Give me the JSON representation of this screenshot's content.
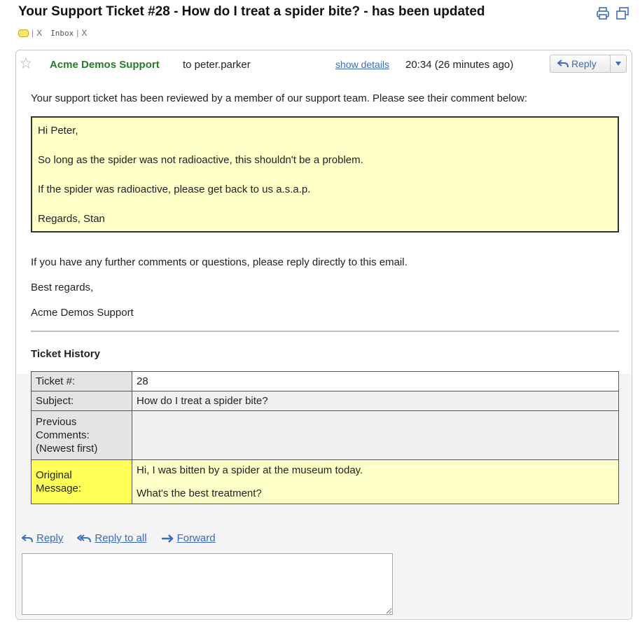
{
  "header": {
    "subject": "Your Support Ticket #28 - How do I treat a spider bite? - has been updated",
    "labels": [
      {
        "name": "",
        "remove": "X"
      },
      {
        "name": "Inbox",
        "remove": "X"
      }
    ],
    "icons": [
      "print-icon",
      "new-window-icon"
    ]
  },
  "message": {
    "sender": "Acme Demos Support",
    "recipient": "to peter.parker",
    "show_details": "show details",
    "timestamp": "20:34 (26 minutes ago)",
    "reply_button": "Reply",
    "intro": "Your support ticket has been reviewed by a member of our support team.  Please see their comment below:",
    "comment": {
      "greeting": "Hi Peter,",
      "line1": "So long as the spider was not radioactive, this shouldn't be a problem.",
      "line2": "If the spider was radioactive, please get back to us a.s.a.p.",
      "signoff": "Regards, Stan"
    },
    "further": "If you have any further comments or questions, please reply directly to this email.",
    "best": "Best regards,",
    "signature": "Acme Demos Support",
    "history_title": "Ticket History",
    "history": {
      "ticket_label": "Ticket #:",
      "ticket_value": "28",
      "subject_label": "Subject:",
      "subject_value": "How do I treat a spider bite?",
      "previous_label": [
        "Previous",
        "Comments:",
        "(Newest first)"
      ],
      "previous_value": "",
      "original_label": [
        "Original",
        "Message:"
      ],
      "original_line1": "Hi, I was bitten by a spider at the museum today.",
      "original_line2": "What's the best treatment?"
    }
  },
  "actions": {
    "reply": "Reply",
    "reply_all": "Reply to all",
    "forward": "Forward"
  },
  "reply_box": {
    "value": ""
  },
  "colors": {
    "sender": "#2a7a2a",
    "link": "#3b6bbd",
    "comment_bg": "#ffffc8",
    "original_label_bg": "#ffff55"
  }
}
